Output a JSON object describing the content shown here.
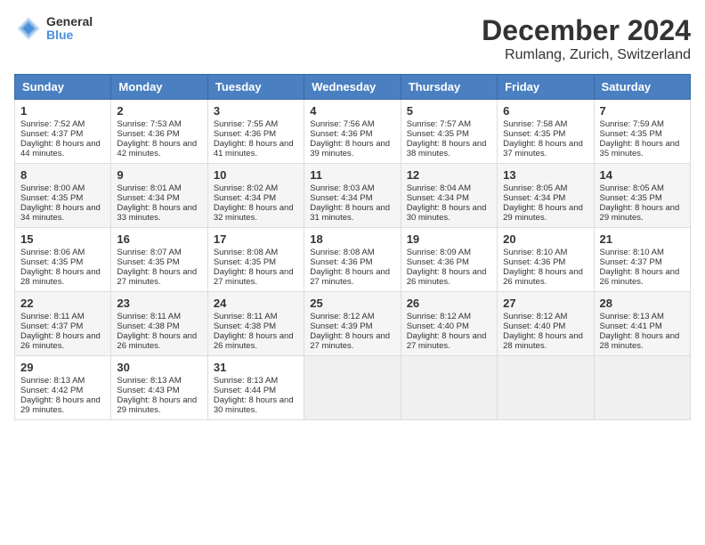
{
  "header": {
    "logo_line1": "General",
    "logo_line2": "Blue",
    "title": "December 2024",
    "subtitle": "Rumlang, Zurich, Switzerland"
  },
  "days_of_week": [
    "Sunday",
    "Monday",
    "Tuesday",
    "Wednesday",
    "Thursday",
    "Friday",
    "Saturday"
  ],
  "weeks": [
    [
      {
        "day": 1,
        "sunrise": "7:52 AM",
        "sunset": "4:37 PM",
        "daylight": "8 hours and 44 minutes."
      },
      {
        "day": 2,
        "sunrise": "7:53 AM",
        "sunset": "4:36 PM",
        "daylight": "8 hours and 42 minutes."
      },
      {
        "day": 3,
        "sunrise": "7:55 AM",
        "sunset": "4:36 PM",
        "daylight": "8 hours and 41 minutes."
      },
      {
        "day": 4,
        "sunrise": "7:56 AM",
        "sunset": "4:36 PM",
        "daylight": "8 hours and 39 minutes."
      },
      {
        "day": 5,
        "sunrise": "7:57 AM",
        "sunset": "4:35 PM",
        "daylight": "8 hours and 38 minutes."
      },
      {
        "day": 6,
        "sunrise": "7:58 AM",
        "sunset": "4:35 PM",
        "daylight": "8 hours and 37 minutes."
      },
      {
        "day": 7,
        "sunrise": "7:59 AM",
        "sunset": "4:35 PM",
        "daylight": "8 hours and 35 minutes."
      }
    ],
    [
      {
        "day": 8,
        "sunrise": "8:00 AM",
        "sunset": "4:35 PM",
        "daylight": "8 hours and 34 minutes."
      },
      {
        "day": 9,
        "sunrise": "8:01 AM",
        "sunset": "4:34 PM",
        "daylight": "8 hours and 33 minutes."
      },
      {
        "day": 10,
        "sunrise": "8:02 AM",
        "sunset": "4:34 PM",
        "daylight": "8 hours and 32 minutes."
      },
      {
        "day": 11,
        "sunrise": "8:03 AM",
        "sunset": "4:34 PM",
        "daylight": "8 hours and 31 minutes."
      },
      {
        "day": 12,
        "sunrise": "8:04 AM",
        "sunset": "4:34 PM",
        "daylight": "8 hours and 30 minutes."
      },
      {
        "day": 13,
        "sunrise": "8:05 AM",
        "sunset": "4:34 PM",
        "daylight": "8 hours and 29 minutes."
      },
      {
        "day": 14,
        "sunrise": "8:05 AM",
        "sunset": "4:35 PM",
        "daylight": "8 hours and 29 minutes."
      }
    ],
    [
      {
        "day": 15,
        "sunrise": "8:06 AM",
        "sunset": "4:35 PM",
        "daylight": "8 hours and 28 minutes."
      },
      {
        "day": 16,
        "sunrise": "8:07 AM",
        "sunset": "4:35 PM",
        "daylight": "8 hours and 27 minutes."
      },
      {
        "day": 17,
        "sunrise": "8:08 AM",
        "sunset": "4:35 PM",
        "daylight": "8 hours and 27 minutes."
      },
      {
        "day": 18,
        "sunrise": "8:08 AM",
        "sunset": "4:36 PM",
        "daylight": "8 hours and 27 minutes."
      },
      {
        "day": 19,
        "sunrise": "8:09 AM",
        "sunset": "4:36 PM",
        "daylight": "8 hours and 26 minutes."
      },
      {
        "day": 20,
        "sunrise": "8:10 AM",
        "sunset": "4:36 PM",
        "daylight": "8 hours and 26 minutes."
      },
      {
        "day": 21,
        "sunrise": "8:10 AM",
        "sunset": "4:37 PM",
        "daylight": "8 hours and 26 minutes."
      }
    ],
    [
      {
        "day": 22,
        "sunrise": "8:11 AM",
        "sunset": "4:37 PM",
        "daylight": "8 hours and 26 minutes."
      },
      {
        "day": 23,
        "sunrise": "8:11 AM",
        "sunset": "4:38 PM",
        "daylight": "8 hours and 26 minutes."
      },
      {
        "day": 24,
        "sunrise": "8:11 AM",
        "sunset": "4:38 PM",
        "daylight": "8 hours and 26 minutes."
      },
      {
        "day": 25,
        "sunrise": "8:12 AM",
        "sunset": "4:39 PM",
        "daylight": "8 hours and 27 minutes."
      },
      {
        "day": 26,
        "sunrise": "8:12 AM",
        "sunset": "4:40 PM",
        "daylight": "8 hours and 27 minutes."
      },
      {
        "day": 27,
        "sunrise": "8:12 AM",
        "sunset": "4:40 PM",
        "daylight": "8 hours and 28 minutes."
      },
      {
        "day": 28,
        "sunrise": "8:13 AM",
        "sunset": "4:41 PM",
        "daylight": "8 hours and 28 minutes."
      }
    ],
    [
      {
        "day": 29,
        "sunrise": "8:13 AM",
        "sunset": "4:42 PM",
        "daylight": "8 hours and 29 minutes."
      },
      {
        "day": 30,
        "sunrise": "8:13 AM",
        "sunset": "4:43 PM",
        "daylight": "8 hours and 29 minutes."
      },
      {
        "day": 31,
        "sunrise": "8:13 AM",
        "sunset": "4:44 PM",
        "daylight": "8 hours and 30 minutes."
      },
      null,
      null,
      null,
      null
    ]
  ]
}
